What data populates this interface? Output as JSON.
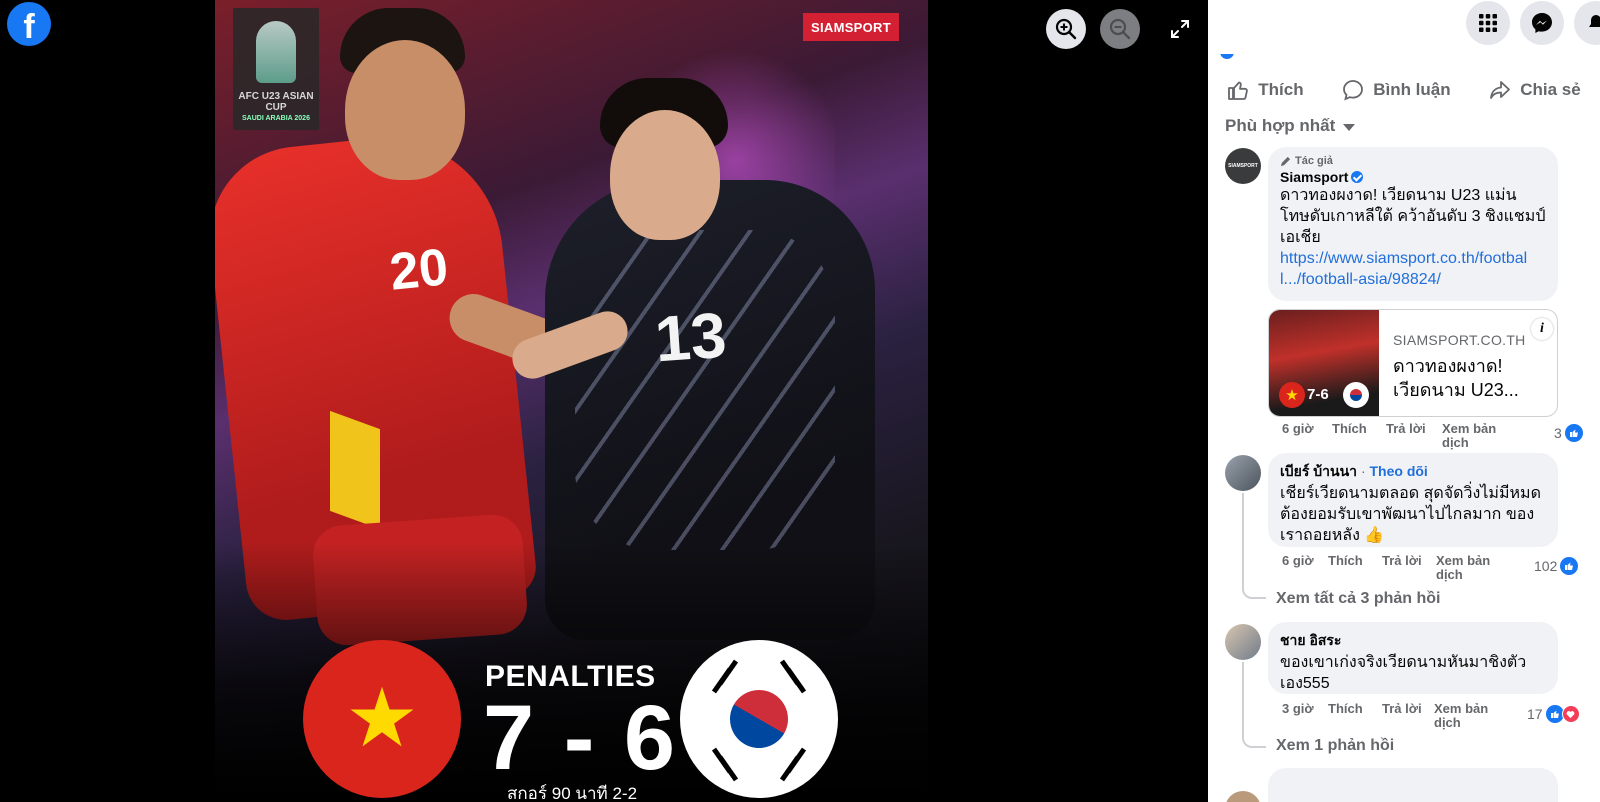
{
  "viewer": {
    "brand_letter": "f",
    "photo": {
      "source_tag": "SIAMSPORT",
      "cup_badge": "AFC U23 ASIAN CUP",
      "cup_badge_sub": "SAUDI ARABIA 2026",
      "player_left_number": "20",
      "player_right_number": "13",
      "score_label": "PENALTIES",
      "score_value": "7 - 6",
      "score_sub": "สกอร์ 90 นาที 2-2"
    },
    "icons": [
      "zoom-in-icon",
      "zoom-out-icon",
      "fullscreen-icon"
    ]
  },
  "panel": {
    "actions": {
      "like": "Thích",
      "comment": "Bình luận",
      "share": "Chia sẻ"
    },
    "sort_label": "Phù hợp nhất",
    "comments": [
      {
        "author_badge": "Tác giả",
        "author": "Siamsport",
        "avatar_text": "SIAMSPORT",
        "text": "ดาวทองผงาด! เวียดนาม U23 แม่นโทษดับเกาหลีใต้ คว้าอันดับ 3 ชิงแชมป์เอเชีย",
        "link": "https://www.siamsport.co.th/football.../football-asia/98824/",
        "card": {
          "domain": "SIAMSPORT.CO.TH",
          "title": "ดาวทองผงาด! เวียดนาม U23...",
          "thumb_score": "7-6"
        },
        "time": "6 giờ",
        "like": "Thích",
        "reply": "Trả lời",
        "translate": "Xem bản dịch",
        "reactions": "3"
      },
      {
        "author": "เบียร์ บ้านนา",
        "follow": "Theo dõi",
        "text": "เชียร์เวียดนามตลอด สุดจัดวิ่งไม่มีหมด ต้องยอมรับเขาพัฒนาไปไกลมาก ของเราถอยหลัง 👍",
        "time": "6 giờ",
        "like": "Thích",
        "reply": "Trả lời",
        "translate": "Xem bản dịch",
        "reactions": "102",
        "view_replies": "Xem tất cả 3 phản hồi"
      },
      {
        "author": "ชาย อิสระ",
        "text": "ของเขาเก่งจริงเวียดนามหันมาชิงตัวเอง555",
        "time": "3 giờ",
        "like": "Thích",
        "reply": "Trả lời",
        "translate": "Xem bản dịch",
        "reactions": "17",
        "view_replies": "Xem 1 phản hồi"
      }
    ],
    "colors": {
      "facebook_blue": "#1877f2",
      "link": "#216fdb",
      "muted_text": "#65676b",
      "bubble_bg": "#f0f2f5",
      "heart": "#f33e58"
    }
  }
}
